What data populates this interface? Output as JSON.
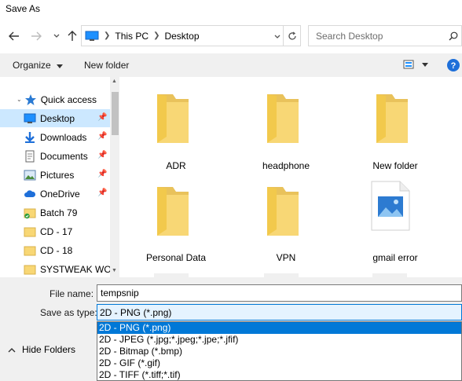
{
  "window": {
    "title": "Save As"
  },
  "nav": {
    "address_parts": [
      "This PC",
      "Desktop"
    ],
    "search_placeholder": "Search Desktop"
  },
  "toolbar": {
    "organize_label": "Organize",
    "new_folder_label": "New folder"
  },
  "sidebar": {
    "items": [
      {
        "label": "Quick access",
        "icon": "star-icon"
      },
      {
        "label": "Desktop",
        "icon": "desktop-icon",
        "pinned": true,
        "selected": true
      },
      {
        "label": "Downloads",
        "icon": "download-icon",
        "pinned": true
      },
      {
        "label": "Documents",
        "icon": "documents-icon",
        "pinned": true
      },
      {
        "label": "Pictures",
        "icon": "pictures-icon",
        "pinned": true
      },
      {
        "label": "OneDrive",
        "icon": "cloud-icon",
        "pinned": true
      },
      {
        "label": "Batch 79",
        "icon": "folder-icon"
      },
      {
        "label": "CD - 17",
        "icon": "folder-icon"
      },
      {
        "label": "CD - 18",
        "icon": "folder-icon"
      },
      {
        "label": "SYSTWEAK WOR",
        "icon": "folder-icon"
      }
    ]
  },
  "files": [
    {
      "name": "ADR",
      "type": "folder"
    },
    {
      "name": "headphone",
      "type": "folder"
    },
    {
      "name": "New folder",
      "type": "folder"
    },
    {
      "name": "Personal Data",
      "type": "folder"
    },
    {
      "name": "VPN",
      "type": "folder"
    },
    {
      "name": "gmail error",
      "type": "image"
    }
  ],
  "form": {
    "file_name_label": "File name:",
    "file_name_value": "tempsnip",
    "save_type_label": "Save as type:",
    "save_type_value": "2D - PNG (*.png)",
    "type_options": [
      "2D - PNG (*.png)",
      "2D - JPEG (*.jpg;*.jpeg;*.jpe;*.jfif)",
      "2D - Bitmap (*.bmp)",
      "2D - GIF (*.gif)",
      "2D - TIFF (*.tiff;*.tif)"
    ]
  },
  "footer": {
    "hide_folders_label": "Hide Folders"
  },
  "colors": {
    "accent": "#0078d7",
    "selection": "#cce8ff",
    "folder": "#f8d775"
  }
}
